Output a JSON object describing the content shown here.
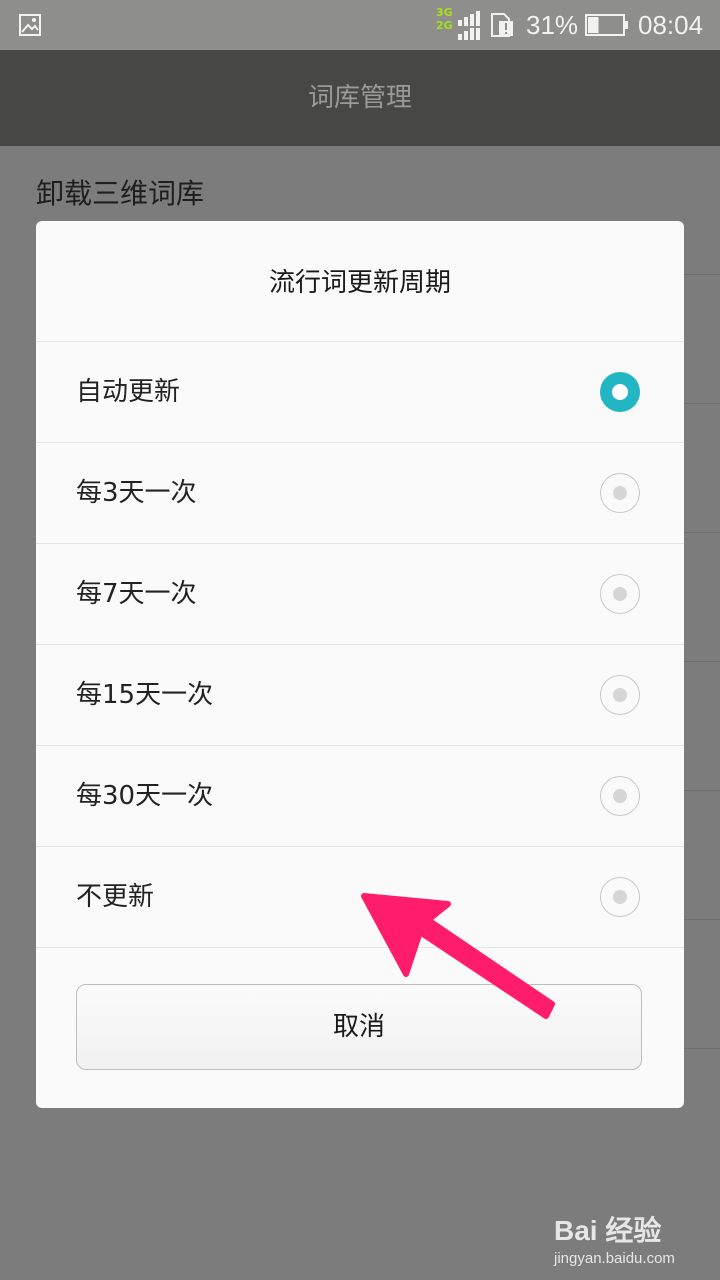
{
  "status_bar": {
    "network_top": "3G",
    "network_bottom": "2G",
    "battery_percent": "31%",
    "battery_level": 0.31,
    "time": "08:04",
    "icons": [
      "image-icon",
      "signal-icon",
      "sim-alert-icon",
      "battery-icon"
    ]
  },
  "app_bar": {
    "title": "词库管理"
  },
  "background_list": {
    "first_item": "卸载三维词库"
  },
  "dialog": {
    "title": "流行词更新周期",
    "options": [
      {
        "label": "自动更新",
        "selected": true
      },
      {
        "label": "每3天一次",
        "selected": false
      },
      {
        "label": "每7天一次",
        "selected": false
      },
      {
        "label": "每15天一次",
        "selected": false
      },
      {
        "label": "每30天一次",
        "selected": false
      },
      {
        "label": "不更新",
        "selected": false
      }
    ],
    "cancel_label": "取消"
  },
  "colors": {
    "accent": "#22b5c4",
    "arrow": "#ff1c6a"
  },
  "watermark": {
    "brand": "Bai 经验",
    "url": "jingyan.baidu.com"
  }
}
